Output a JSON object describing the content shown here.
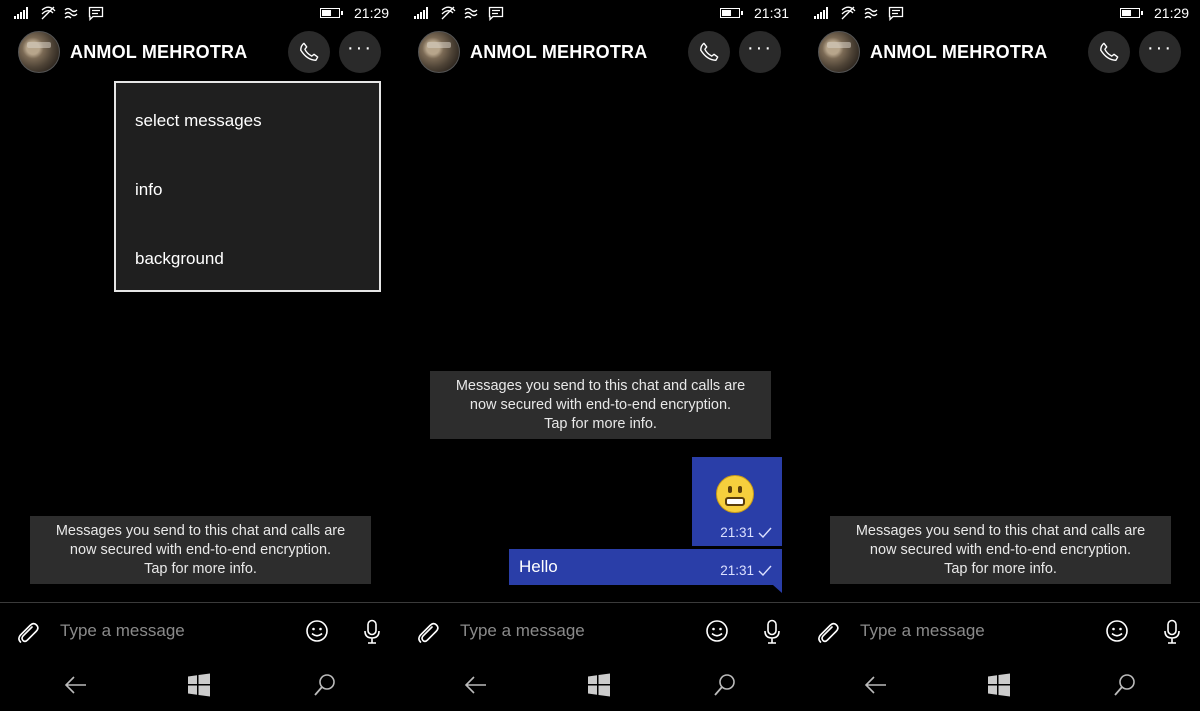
{
  "screens": [
    {
      "status": {
        "time": "21:29"
      },
      "header": {
        "contact_name": "ANMOL MEHROTRA"
      },
      "menu": {
        "items": [
          "select messages",
          "info",
          "background"
        ]
      },
      "encryption_notice": [
        "Messages you send to this chat and calls are",
        "now secured with end-to-end encryption.",
        "Tap for more info."
      ],
      "composer": {
        "placeholder": "Type a message"
      }
    },
    {
      "status": {
        "time": "21:31"
      },
      "header": {
        "contact_name": "ANMOL MEHROTRA"
      },
      "encryption_notice": [
        "Messages you send to this chat and calls are",
        "now secured with end-to-end encryption.",
        "Tap for more info."
      ],
      "messages": [
        {
          "type": "emoji",
          "emoji": "grimacing-face",
          "time": "21:31"
        },
        {
          "type": "text",
          "text": "Hello",
          "time": "21:31"
        }
      ],
      "composer": {
        "placeholder": "Type a message"
      }
    },
    {
      "status": {
        "time": "21:29"
      },
      "header": {
        "contact_name": "ANMOL MEHROTRA"
      },
      "encryption_notice": [
        "Messages you send to this chat and calls are",
        "now secured with end-to-end encryption.",
        "Tap for more info."
      ],
      "composer": {
        "placeholder": "Type a message"
      }
    }
  ],
  "colors": {
    "background": "#000000",
    "bubble": "#2a3ea8",
    "notice": "#2d2d2d",
    "menu": "#1f1f1f"
  },
  "icons": [
    "signal-icon",
    "wifi-icon",
    "nfc-icon",
    "message-icon",
    "battery-icon",
    "phone-icon",
    "more-icon",
    "attach-icon",
    "emoji-icon",
    "mic-icon",
    "back-icon",
    "windows-icon",
    "search-icon",
    "read-check-icon"
  ]
}
